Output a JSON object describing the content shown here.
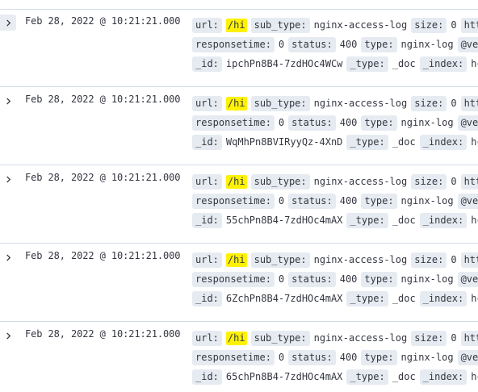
{
  "rows": [
    {
      "timestamp": "Feb 28, 2022 @ 10:21:21.000",
      "lines": [
        [
          {
            "k": "url:",
            "v": "/hi",
            "hl": true
          },
          {
            "k": "sub_type:",
            "v": "nginx-access-log"
          },
          {
            "k": "size:",
            "v": "0"
          },
          {
            "k": "htt",
            "v": ""
          }
        ],
        [
          {
            "k": "responsetime:",
            "v": "0"
          },
          {
            "k": "status:",
            "v": "400"
          },
          {
            "k": "type:",
            "v": "nginx-log"
          },
          {
            "k": "@ve",
            "v": ""
          }
        ],
        [
          {
            "k": "_id:",
            "v": "ipchPn8B4-7zdHOc4WCw"
          },
          {
            "k": "_type:",
            "v": "_doc"
          },
          {
            "k": "_index:",
            "v": "hc"
          }
        ]
      ]
    },
    {
      "timestamp": "Feb 28, 2022 @ 10:21:21.000",
      "lines": [
        [
          {
            "k": "url:",
            "v": "/hi",
            "hl": true
          },
          {
            "k": "sub_type:",
            "v": "nginx-access-log"
          },
          {
            "k": "size:",
            "v": "0"
          },
          {
            "k": "htt",
            "v": ""
          }
        ],
        [
          {
            "k": "responsetime:",
            "v": "0"
          },
          {
            "k": "status:",
            "v": "400"
          },
          {
            "k": "type:",
            "v": "nginx-log"
          },
          {
            "k": "@ve",
            "v": ""
          }
        ],
        [
          {
            "k": "_id:",
            "v": "WqMhPn8BVIRyyQz-4XnD"
          },
          {
            "k": "_type:",
            "v": "_doc"
          },
          {
            "k": "_index:",
            "v": "hc"
          }
        ]
      ]
    },
    {
      "timestamp": "Feb 28, 2022 @ 10:21:21.000",
      "lines": [
        [
          {
            "k": "url:",
            "v": "/hi",
            "hl": true
          },
          {
            "k": "sub_type:",
            "v": "nginx-access-log"
          },
          {
            "k": "size:",
            "v": "0"
          },
          {
            "k": "htt",
            "v": ""
          }
        ],
        [
          {
            "k": "responsetime:",
            "v": "0"
          },
          {
            "k": "status:",
            "v": "400"
          },
          {
            "k": "type:",
            "v": "nginx-log"
          },
          {
            "k": "@ve",
            "v": ""
          }
        ],
        [
          {
            "k": "_id:",
            "v": "55chPn8B4-7zdHOc4mAX"
          },
          {
            "k": "_type:",
            "v": "_doc"
          },
          {
            "k": "_index:",
            "v": "hc"
          }
        ]
      ]
    },
    {
      "timestamp": "Feb 28, 2022 @ 10:21:21.000",
      "lines": [
        [
          {
            "k": "url:",
            "v": "/hi",
            "hl": true
          },
          {
            "k": "sub_type:",
            "v": "nginx-access-log"
          },
          {
            "k": "size:",
            "v": "0"
          },
          {
            "k": "htt",
            "v": ""
          }
        ],
        [
          {
            "k": "responsetime:",
            "v": "0"
          },
          {
            "k": "status:",
            "v": "400"
          },
          {
            "k": "type:",
            "v": "nginx-log"
          },
          {
            "k": "@ve",
            "v": ""
          }
        ],
        [
          {
            "k": "_id:",
            "v": "6ZchPn8B4-7zdHOc4mAX"
          },
          {
            "k": "_type:",
            "v": "_doc"
          },
          {
            "k": "_index:",
            "v": "hc"
          }
        ]
      ]
    },
    {
      "timestamp": "Feb 28, 2022 @ 10:21:21.000",
      "lines": [
        [
          {
            "k": "url:",
            "v": "/hi",
            "hl": true
          },
          {
            "k": "sub_type:",
            "v": "nginx-access-log"
          },
          {
            "k": "size:",
            "v": "0"
          },
          {
            "k": "htt",
            "v": ""
          }
        ],
        [
          {
            "k": "responsetime:",
            "v": "0"
          },
          {
            "k": "status:",
            "v": "400"
          },
          {
            "k": "type:",
            "v": "nginx-log"
          },
          {
            "k": "@ve",
            "v": ""
          }
        ],
        [
          {
            "k": "_id:",
            "v": "65chPn8B4-7zdHOc4mAX"
          },
          {
            "k": "_type:",
            "v": "_doc"
          },
          {
            "k": "_index:",
            "v": "hc"
          }
        ]
      ]
    }
  ],
  "icons": {
    "expand": "chevron-right-icon"
  },
  "colors": {
    "highlight": "#fff200",
    "field_key_bg": "#e6ebf2",
    "text": "#343741",
    "divider": "#d3dae6"
  }
}
